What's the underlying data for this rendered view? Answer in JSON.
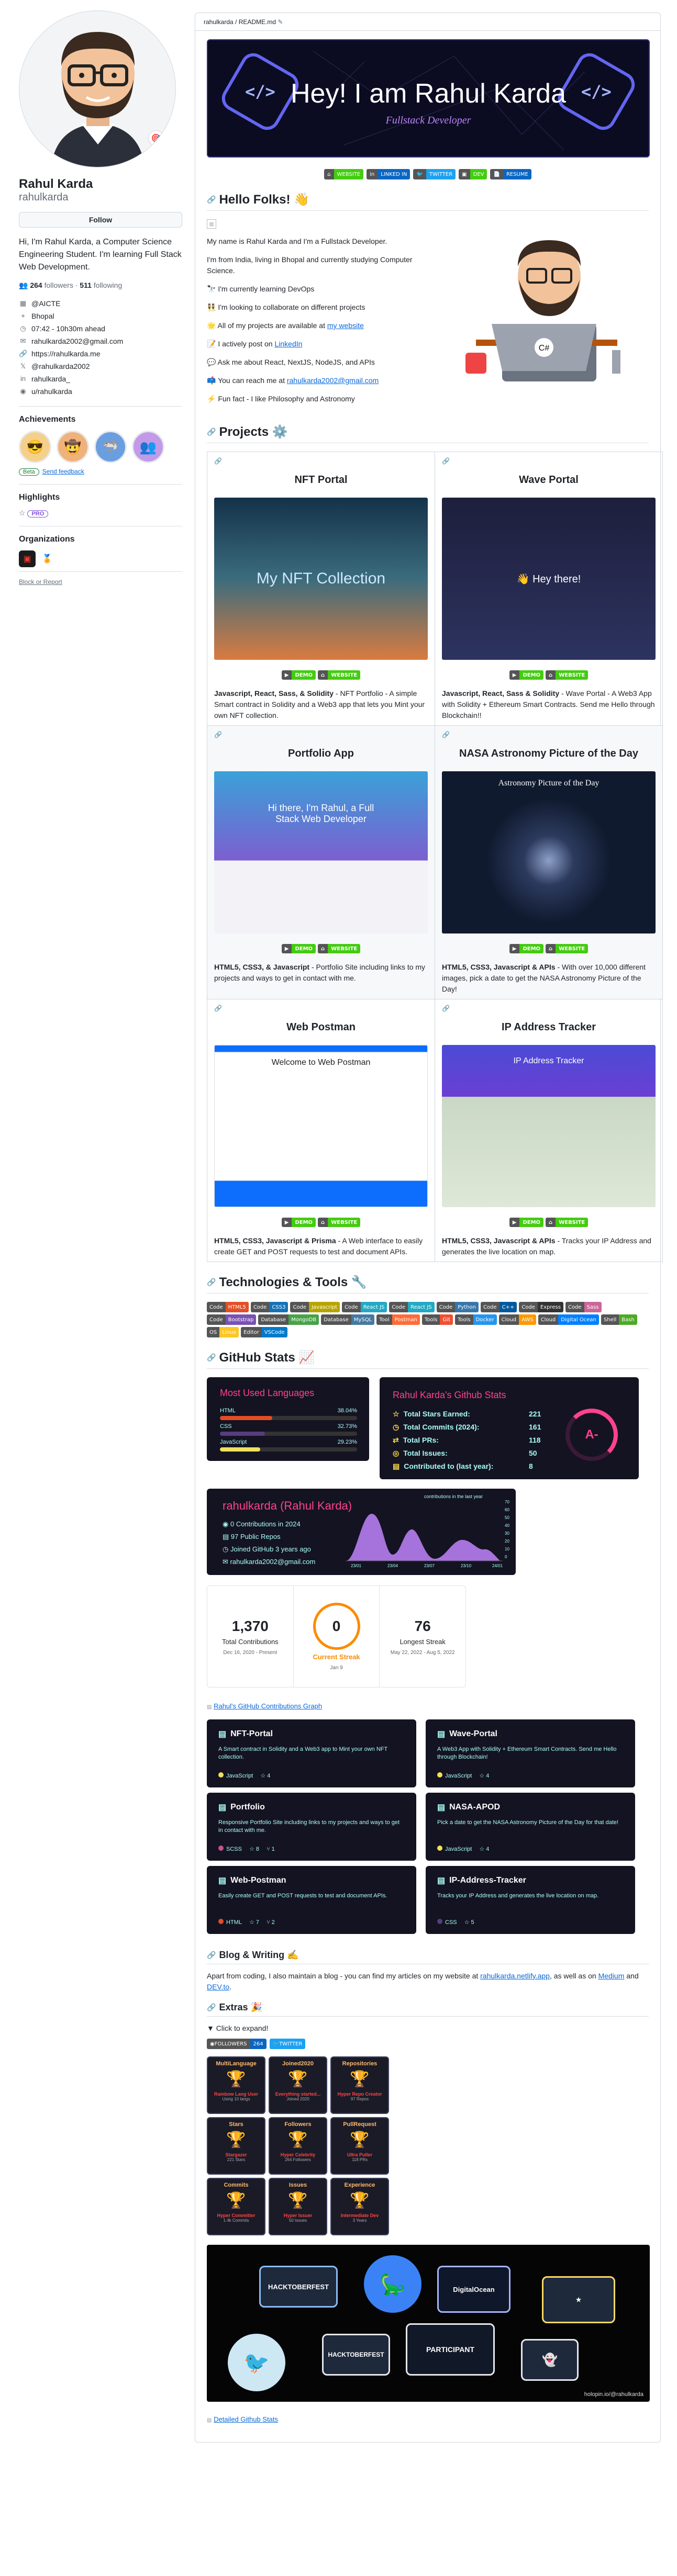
{
  "profile": {
    "name": "Rahul Karda",
    "login": "rahulkarda",
    "follow_label": "Follow",
    "bio": "Hi, I'm Rahul Karda, a Computer Science Engineering Student. I'm learning Full Stack Web Development.",
    "followers_count": "264",
    "followers_label": "followers",
    "following_count": "511",
    "following_label": "following",
    "details": [
      {
        "icon": "organization-icon",
        "text": "@AICTE"
      },
      {
        "icon": "location-icon",
        "text": "Bhopal"
      },
      {
        "icon": "clock-icon",
        "text": "07:42 - 10h30m ahead"
      },
      {
        "icon": "mail-icon",
        "text": "rahulkarda2002@gmail.com"
      },
      {
        "icon": "link-icon",
        "text": "https://rahulkarda.me"
      },
      {
        "icon": "twitter-icon",
        "text": "@rahulkarda2002"
      },
      {
        "icon": "linkedin-icon",
        "text": "rahulkarda_"
      },
      {
        "icon": "reddit-icon",
        "text": "u/rahulkarda"
      }
    ],
    "achievements_title": "Achievements",
    "beta_label": "Beta",
    "feedback_label": "Send feedback",
    "highlights_title": "Highlights",
    "pro_label": "PRO",
    "organizations_title": "Organizations",
    "block_label": "Block or Report"
  },
  "readme": {
    "path": "rahulkarda",
    "file": "README.md",
    "banner_title": "Hey! I am Rahul Karda",
    "banner_subtitle": "Fullstack Developer",
    "top_shields": [
      {
        "l": "WEBSITE",
        "r": "",
        "c": "#4c1"
      },
      {
        "l": "LINKED IN",
        "r": "",
        "c": "#0a66c2"
      },
      {
        "l": "TWITTER",
        "r": "",
        "c": "#1da1f2"
      },
      {
        "l": "DEV",
        "r": "",
        "c": "#333"
      },
      {
        "l": "RESUME",
        "r": "",
        "c": "#e34f26"
      }
    ],
    "hello_title": "Hello Folks! 👋",
    "hello_lines": [
      "My name is Rahul Karda and I'm a Fullstack Developer.",
      "I'm from India, living in Bhopal and currently studying Computer Science.",
      "🔭 I'm currently learning DevOps",
      "👯 I'm looking to collaborate on different projects",
      "🌟 All of my projects are available at",
      "📝 I actively post on",
      "💬 Ask me about React, NextJS, NodeJS, and APIs",
      "📫 You can reach me at",
      "⚡ Fun fact - I like Philosophy and Astronomy"
    ],
    "hello_links": {
      "website": "my website",
      "linkedin": "LinkedIn",
      "email": "rahulkarda2002@gmail.com"
    },
    "projects_title": "Projects ⚙️",
    "projects": [
      {
        "title": "NFT Portal",
        "img_text": "My NFT Collection",
        "badge1": "DEMO",
        "badge2": "WEBSITE",
        "tech": "Javascript, React, Sass, & Solidity",
        "desc": " - NFT Portfolio - A simple Smart contract in Solidity and a Web3 app that lets you Mint your own NFT collection.",
        "bg": "linear-gradient(180deg,#14324a,#3b6c7d,#d97b40)"
      },
      {
        "title": "Wave Portal",
        "img_text": "👋 Hey there!",
        "badge1": "DEMO",
        "badge2": "WEBSITE",
        "tech": "Javascript, React, Sass & Solidity",
        "desc": " - Wave Portal - A Web3 App with Solidity + Ethereum Smart Contracts. Send me Hello through Blockchain!!",
        "bg": "linear-gradient(180deg,#1d1f3c,#2d3360)"
      },
      {
        "title": "Portfolio App",
        "img_text": "Hi there, I'm Rahul, a Full Stack Web Developer",
        "badge1": "DEMO",
        "badge2": "WEBSITE",
        "tech": "HTML5, CSS3, & Javascript",
        "desc": " - Portfolio Site including links to my projects and ways to get in contact with me.",
        "bg": "linear-gradient(135deg,#3aa1d8,#7c5fd0 60%,#f2f2f7 61%)"
      },
      {
        "title": "NASA Astronomy Picture of the Day",
        "img_text": "Astronomy Picture of the Day",
        "badge1": "DEMO",
        "badge2": "WEBSITE",
        "tech": "HTML5, CSS3, Javascript & APIs",
        "desc": " - With over 10,000 different images, pick a date to get the NASA Astronomy Picture of the Day!",
        "bg": "radial-gradient(circle at 50% 55%,#8ea0c8 0,#2c3a5e 18%,#0f1a2e 45%)"
      },
      {
        "title": "Web Postman",
        "img_text": "Welcome to Web Postman",
        "badge1": "DEMO",
        "badge2": "WEBSITE",
        "tech": "HTML5, CSS3, Javascript & Prisma",
        "desc": " - A Web interface to easily create GET and POST requests to test and document APIs.",
        "bg": "linear-gradient(180deg,#0d6efd 0,#0d6efd 4%,#fff 4%,#fff 85%,#0d6efd 85%)"
      },
      {
        "title": "IP Address Tracker",
        "img_text": "IP Address Tracker",
        "badge1": "DEMO",
        "badge2": "WEBSITE",
        "tech": "HTML5, CSS3, Javascript & APIs",
        "desc": " - Tracks your IP Address and generates the live location on map.",
        "bg": "linear-gradient(180deg,#4b4bd6 0,#6a3fd3 32%,#c9d8c4 32%,#dfe8d8 100%)"
      }
    ],
    "tech_title": "Technologies & Tools 🔧",
    "tech_badges": [
      {
        "x": "Code",
        "y": "HTML5",
        "c": "#e34f26"
      },
      {
        "x": "Code",
        "y": "CSS3",
        "c": "#1572b6"
      },
      {
        "x": "Code",
        "y": "Javascript",
        "c": "#b8a400"
      },
      {
        "x": "Code",
        "y": "React JS",
        "c": "#23a9c4"
      },
      {
        "x": "Code",
        "y": "React JS",
        "c": "#23a9c4"
      },
      {
        "x": "Code",
        "y": "Python",
        "c": "#3776ab"
      },
      {
        "x": "Code",
        "y": "C++",
        "c": "#00599c"
      },
      {
        "x": "Code",
        "y": "Express",
        "c": "#333"
      },
      {
        "x": "Code",
        "y": "Sass",
        "c": "#cc6699"
      },
      {
        "x": "Code",
        "y": "Bootstrap",
        "c": "#7952b3"
      },
      {
        "x": "Database",
        "y": "MongoDB",
        "c": "#47a248"
      },
      {
        "x": "Database",
        "y": "MySQL",
        "c": "#4479a1"
      },
      {
        "x": "Tool",
        "y": "Postman",
        "c": "#ff6c37"
      },
      {
        "x": "Tools",
        "y": "Git",
        "c": "#f05032"
      },
      {
        "x": "Tools",
        "y": "Docker",
        "c": "#2496ed"
      },
      {
        "x": "Cloud",
        "y": "AWS",
        "c": "#ff9900"
      },
      {
        "x": "Cloud",
        "y": "Digital Ocean",
        "c": "#0080ff"
      },
      {
        "x": "Shell",
        "y": "Bash",
        "c": "#4eaa25"
      },
      {
        "x": "OS",
        "y": "Linux",
        "c": "#fcc624"
      },
      {
        "x": "Editor",
        "y": "VSCode",
        "c": "#007acc"
      }
    ],
    "stats_title": "GitHub Stats 📈",
    "langs": {
      "title": "Most Used Languages",
      "items": [
        {
          "name": "HTML",
          "pct": "38.04%",
          "value": 38.04,
          "color": "#e34c26"
        },
        {
          "name": "CSS",
          "pct": "32.73%",
          "value": 32.73,
          "color": "#563d7c"
        },
        {
          "name": "JavaScript",
          "pct": "29.23%",
          "value": 29.23,
          "color": "#f1e05a"
        }
      ]
    },
    "gh_stats": {
      "title": "Rahul Karda's Github Stats",
      "rows": [
        {
          "label": "Total Stars Earned:",
          "value": "221"
        },
        {
          "label": "Total Commits (2024):",
          "value": "161"
        },
        {
          "label": "Total PRs:",
          "value": "118"
        },
        {
          "label": "Total Issues:",
          "value": "50"
        },
        {
          "label": "Contributed to (last year):",
          "value": "8"
        }
      ],
      "grade": "A-"
    },
    "activity": {
      "title": "rahulkarda (Rahul Karda)",
      "rows": [
        "0 Contributions in 2024",
        "97 Public Repos",
        "Joined GitHub 3 years ago",
        "rahulkarda2002@gmail.com"
      ],
      "chart_label": "contributions in the last year",
      "x_labels": [
        "23/01",
        "23/04",
        "23/07",
        "23/10",
        "24/01"
      ],
      "y_ticks": [
        "70",
        "60",
        "50",
        "40",
        "30",
        "20",
        "10",
        "0"
      ]
    },
    "streak": {
      "total": "1,370",
      "total_label": "Total Contributions",
      "total_range": "Dec 16, 2020 - Present",
      "current": "0",
      "current_label": "Current Streak",
      "current_date": "Jan 9",
      "longest": "76",
      "longest_label": "Longest Streak",
      "longest_range": "May 22, 2022 - Aug 5, 2022"
    },
    "contrib_graph_alt": "Rahul's GitHub Contributions Graph",
    "pins": [
      {
        "title": "NFT-Portal",
        "desc": "A Smart contract in Solidity and a Web3 app to Mint your own NFT collection.",
        "lang": "JavaScript",
        "lang_color": "#f1e05a",
        "stars": "4",
        "forks": ""
      },
      {
        "title": "Wave-Portal",
        "desc": "A Web3 App with Solidity + Ethereum Smart Contracts. Send me Hello through Blockchain!",
        "lang": "JavaScript",
        "lang_color": "#f1e05a",
        "stars": "4",
        "forks": ""
      },
      {
        "title": "Portfolio",
        "desc": "Responsive Portfolio Site including links to my projects and ways to get in contact with me.",
        "lang": "SCSS",
        "lang_color": "#c6538c",
        "stars": "8",
        "forks": "1"
      },
      {
        "title": "NASA-APOD",
        "desc": "Pick a date to get the NASA Astronomy Picture of the Day for that date!",
        "lang": "JavaScript",
        "lang_color": "#f1e05a",
        "stars": "4",
        "forks": ""
      },
      {
        "title": "Web-Postman",
        "desc": "Easily create GET and POST requests to test and document APIs.",
        "lang": "HTML",
        "lang_color": "#e34c26",
        "stars": "7",
        "forks": "2"
      },
      {
        "title": "IP-Address-Tracker",
        "desc": "Tracks your IP Address and generates the live location on map.",
        "lang": "CSS",
        "lang_color": "#563d7c",
        "stars": "5",
        "forks": ""
      }
    ],
    "blog_title": "Blog & Writing ✍️",
    "blog_text_1": "Apart from coding, I also maintain a blog - you can find my articles on my website at ",
    "blog_link_1": "rahulkarda.netlify.app",
    "blog_text_2": ", as well as on ",
    "blog_link_2": "Medium",
    "blog_text_3": " and ",
    "blog_link_3": "DEV.to",
    "blog_text_4": ".",
    "extras_title": "Extras 🎉",
    "expand_label": "▼ Click to expand!",
    "followers_badge": {
      "l": "FOLLOWERS",
      "r": "264"
    },
    "twitter_badge": {
      "l": "TWITTER",
      "r": ""
    },
    "trophies": [
      {
        "h": "MultiLanguage",
        "n": "Rainbow Lang User",
        "s": "Using 10 langs"
      },
      {
        "h": "Joined2020",
        "n": "Everything started...",
        "s": "Joined 2020"
      },
      {
        "h": "Repositories",
        "n": "Hyper Repo Creator",
        "s": "97 Repos"
      },
      {
        "h": "Stars",
        "n": "Stargazer",
        "s": "221 Stars"
      },
      {
        "h": "Followers",
        "n": "Hyper Celebrity",
        "s": "264 Followers"
      },
      {
        "h": "PullRequest",
        "n": "Ultra Puller",
        "s": "118 PRs"
      },
      {
        "h": "Commits",
        "n": "Hyper Committer",
        "s": "1.4k Commits"
      },
      {
        "h": "Issues",
        "n": "Hyper Issuer",
        "s": "50 Issues"
      },
      {
        "h": "Experience",
        "n": "Intermediate Dev",
        "s": "3 Years"
      }
    ],
    "hack_labels": [
      "HACKTOBERFEST",
      "DigitalOcean",
      "PARTICIPANT",
      "HACKTOBERFEST"
    ],
    "hack_credit": "holopin.io/@rahulkarda",
    "detailed_stats_link": "Detailed Github Stats"
  },
  "colors": {
    "accent": "#0969da",
    "card_bg": "#141321",
    "pink": "#fe428e",
    "cyan": "#a9fef7"
  }
}
